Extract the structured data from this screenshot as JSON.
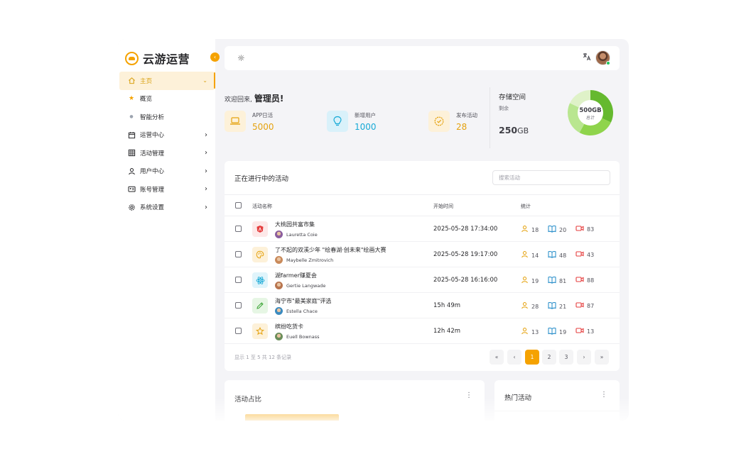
{
  "app": {
    "title": "云游运营"
  },
  "sidebar": {
    "items": [
      {
        "label": "主页",
        "icon": "home-icon"
      },
      {
        "label": "概览",
        "icon": "star-icon"
      },
      {
        "label": "智能分析",
        "icon": "dot-icon"
      },
      {
        "label": "运营中心",
        "icon": "calendar-icon"
      },
      {
        "label": "活动管理",
        "icon": "grid-icon"
      },
      {
        "label": "用户中心",
        "icon": "user-icon"
      },
      {
        "label": "账号管理",
        "icon": "id-card-icon"
      },
      {
        "label": "系统设置",
        "icon": "gear-icon"
      }
    ]
  },
  "welcome": {
    "greeting": "欢迎回来,",
    "name": "管理员!",
    "stats": [
      {
        "label": "APP日活",
        "value": "5000",
        "color": "#e5a20f"
      },
      {
        "label": "新增用户",
        "value": "1000",
        "color": "#16a9d6"
      },
      {
        "label": "发布活动",
        "value": "28",
        "color": "#e5a20f"
      }
    ]
  },
  "storage": {
    "title": "存储空间",
    "subtitle": "剩余",
    "remaining": "250",
    "remaining_unit": "GB",
    "total": "500GB",
    "total_label": "总计",
    "colors": [
      "#65b92f",
      "#8fd44c",
      "#b9e690",
      "#dff2c8"
    ]
  },
  "activities": {
    "title": "正在进行中的活动",
    "search_placeholder": "搜索活动",
    "columns": [
      "活动名称",
      "开始时间",
      "统计"
    ],
    "rows": [
      {
        "name": "大桃园共富市集",
        "user": "Lauretta Coie",
        "time": "2025-05-28 17:34:00",
        "users": "18",
        "reads": "20",
        "videos": "83",
        "icon": "angular-icon",
        "icon_bg": "#fde8e8",
        "icon_color": "#e53e3e"
      },
      {
        "name": "了不起的双溪少年 \"绘春湖·创未来\"绘画大赛",
        "user": "Maybelle Zmitrovich",
        "time": "2025-05-28 19:17:00",
        "users": "14",
        "reads": "48",
        "videos": "43",
        "icon": "palette-icon",
        "icon_bg": "#fdf1d9",
        "icon_color": "#e5a20f"
      },
      {
        "name": "湖farmer赚夏会",
        "user": "Gertie Langwade",
        "time": "2025-05-28 16:16:00",
        "users": "19",
        "reads": "81",
        "videos": "88",
        "icon": "react-icon",
        "icon_bg": "#e0f4fb",
        "icon_color": "#16a9d6"
      },
      {
        "name": "海宁市\"最美家庭\"评选",
        "user": "Estella Chace",
        "time": "15h 49m",
        "users": "28",
        "reads": "21",
        "videos": "87",
        "icon": "pencil-icon",
        "icon_bg": "#e6f6e4",
        "icon_color": "#3fa63a"
      },
      {
        "name": "缤纷吃货卡",
        "user": "Euell Bownass",
        "time": "12h 42m",
        "users": "13",
        "reads": "19",
        "videos": "13",
        "icon": "star-outline-icon",
        "icon_bg": "#fdf1d9",
        "icon_color": "#e5a20f"
      }
    ],
    "footer": "显示 1 至 5 共 12 条记录",
    "pages": [
      "«",
      "‹",
      "1",
      "2",
      "3",
      "›",
      "»"
    ]
  },
  "bottom": {
    "left_title": "活动占比",
    "right_title": "热门活动"
  }
}
